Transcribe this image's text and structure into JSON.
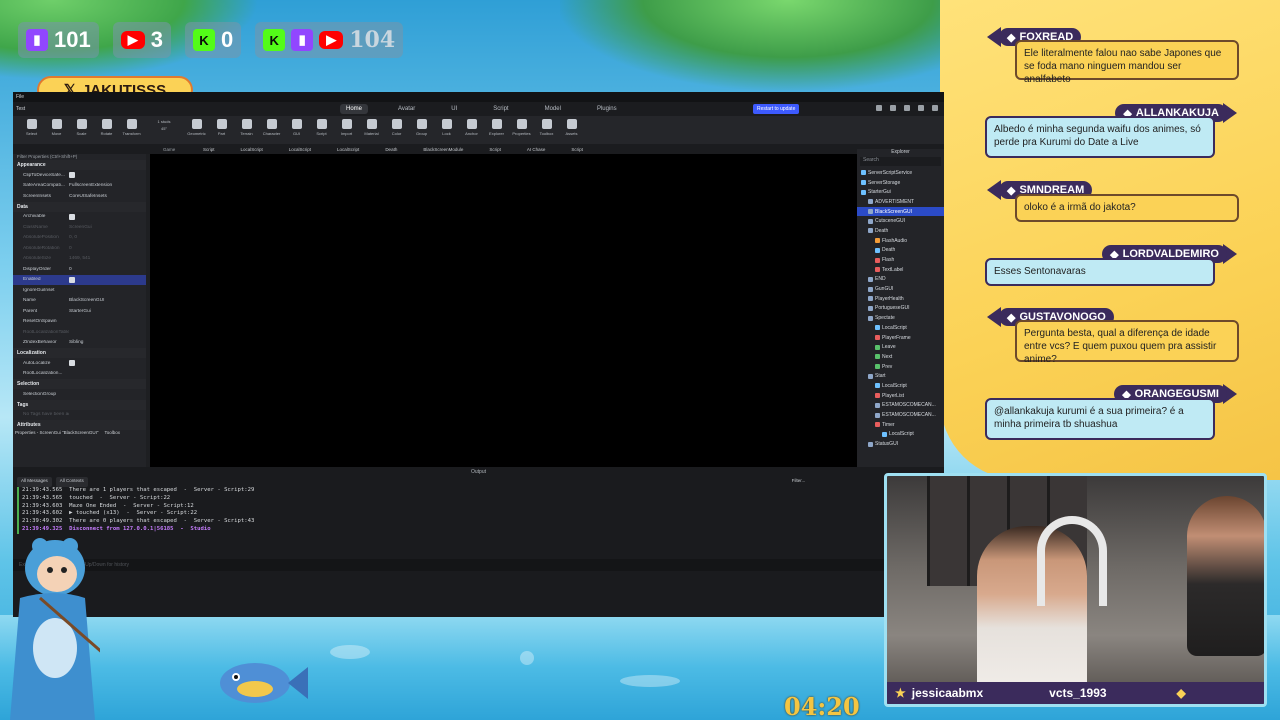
{
  "counters": [
    {
      "platform": "twitch-icon",
      "value": "101"
    },
    {
      "platform": "youtube-icon",
      "value": "3"
    },
    {
      "platform": "kick-icon",
      "value": "0"
    },
    {
      "platform": "all-platforms",
      "value": "104"
    }
  ],
  "handle": "JAKUTISSS",
  "studio": {
    "menu": [
      "File"
    ],
    "place_name": "Test",
    "tabs": [
      "Home",
      "Avatar",
      "UI",
      "Script",
      "Model",
      "Plugins"
    ],
    "active_tab": "Home",
    "restart_label": "Restart to update",
    "tools": [
      "Select",
      "Move",
      "Scale",
      "Rotate",
      "Transform",
      "Geometric",
      "Part",
      "Terrain",
      "Character",
      "GUI",
      "Script",
      "Import",
      "Material",
      "Color",
      "Group",
      "Lock",
      "Anchor",
      "Explorer",
      "Properties",
      "Toolbox",
      "Assets"
    ],
    "snap": {
      "stud": "1 studs",
      "angle": "45°"
    },
    "doc_tabs": [
      "Script",
      "LocalScript",
      "LocalScript",
      "LocalScript",
      "Death",
      "BlackScreenModule",
      "Script",
      "AI Chase",
      "Script"
    ],
    "properties": {
      "title": "Properties - ScreenGui \"BlackScreenGUI\"",
      "filter_placeholder": "Filter Properties (Ctrl+Shift+P)",
      "sections": [
        {
          "name": "Appearance",
          "rows": [
            {
              "name": "ClipToDeviceSafe...",
              "value": "check",
              "disabled": false
            },
            {
              "name": "SafeAreaCompati...",
              "value": "FullscreenExtension",
              "disabled": false
            },
            {
              "name": "ScreenInsets",
              "value": "CoreUISafeInsets",
              "disabled": false
            }
          ]
        },
        {
          "name": "Data",
          "rows": [
            {
              "name": "Archivable",
              "value": "check",
              "disabled": false
            },
            {
              "name": "ClassName",
              "value": "ScreenGui",
              "disabled": true
            },
            {
              "name": "AbsolutePosition",
              "value": "0, 0",
              "disabled": true
            },
            {
              "name": "AbsoluteRotation",
              "value": "0",
              "disabled": true
            },
            {
              "name": "AbsoluteSize",
              "value": "1469, 541",
              "disabled": true
            },
            {
              "name": "DisplayOrder",
              "value": "0",
              "disabled": false
            },
            {
              "name": "Enabled",
              "value": "check",
              "disabled": false,
              "selected": true
            },
            {
              "name": "IgnoreGuiInset",
              "value": "",
              "disabled": false
            },
            {
              "name": "Name",
              "value": "BlackScreenGUI",
              "disabled": false
            },
            {
              "name": "Parent",
              "value": "StarterGui",
              "disabled": false
            },
            {
              "name": "ResetOnSpawn",
              "value": "",
              "disabled": false
            },
            {
              "name": "RootLocalizationTable",
              "value": "",
              "disabled": true
            },
            {
              "name": "ZIndexBehavior",
              "value": "Sibling",
              "disabled": false
            }
          ]
        },
        {
          "name": "Localization",
          "rows": [
            {
              "name": "AutoLocalize",
              "value": "check",
              "disabled": false
            },
            {
              "name": "RootLocalization...",
              "value": "",
              "disabled": false
            }
          ]
        },
        {
          "name": "Selection",
          "rows": [
            {
              "name": "SelectionGroup",
              "value": "",
              "disabled": false
            }
          ]
        },
        {
          "name": "Tags",
          "rows": [
            {
              "name": "No Tags have been added yet",
              "value": "",
              "disabled": true
            }
          ]
        },
        {
          "name": "Attributes",
          "rows": []
        }
      ],
      "footer_tabs": [
        "Properties - ScreenGui \"BlackScreenGUI\"",
        "Toolbox"
      ]
    },
    "viewport_tab": "Game",
    "explorer": {
      "title": "Explorer",
      "search_placeholder": "Search",
      "items": [
        {
          "label": "ServerScriptService",
          "indent": 0,
          "color": "#6ec1ff"
        },
        {
          "label": "ServerStorage",
          "indent": 0,
          "color": "#6ec1ff"
        },
        {
          "label": "StarterGui",
          "indent": 0,
          "color": "#6ec1ff"
        },
        {
          "label": "ADVERTISMENT",
          "indent": 1,
          "color": "#8fa7c9"
        },
        {
          "label": "BlackScreenGUI",
          "indent": 1,
          "color": "#8fa7c9",
          "selected": true
        },
        {
          "label": "CutsceneGUI",
          "indent": 1,
          "color": "#8fa7c9"
        },
        {
          "label": "Death",
          "indent": 1,
          "color": "#8fa7c9"
        },
        {
          "label": "FlashAudio",
          "indent": 2,
          "color": "#f29c38"
        },
        {
          "label": "Death",
          "indent": 2,
          "color": "#6ec1ff"
        },
        {
          "label": "Flash",
          "indent": 2,
          "color": "#e85d5d"
        },
        {
          "label": "TextLabel",
          "indent": 2,
          "color": "#e85d5d"
        },
        {
          "label": "END",
          "indent": 1,
          "color": "#8fa7c9"
        },
        {
          "label": "GunGUI",
          "indent": 1,
          "color": "#8fa7c9"
        },
        {
          "label": "PlayerHealth",
          "indent": 1,
          "color": "#8fa7c9"
        },
        {
          "label": "PortugueseGUI",
          "indent": 1,
          "color": "#8fa7c9"
        },
        {
          "label": "Spectate",
          "indent": 1,
          "color": "#8fa7c9"
        },
        {
          "label": "LocalScript",
          "indent": 2,
          "color": "#6ec1ff"
        },
        {
          "label": "PlayerFrame",
          "indent": 2,
          "color": "#e85d5d"
        },
        {
          "label": "Leave",
          "indent": 2,
          "color": "#59c26b"
        },
        {
          "label": "Next",
          "indent": 2,
          "color": "#59c26b"
        },
        {
          "label": "Prev",
          "indent": 2,
          "color": "#59c26b"
        },
        {
          "label": "Start",
          "indent": 1,
          "color": "#8fa7c9"
        },
        {
          "label": "LocalScript",
          "indent": 2,
          "color": "#6ec1ff"
        },
        {
          "label": "PlayerList",
          "indent": 2,
          "color": "#e85d5d"
        },
        {
          "label": "ESTAMOSCOMECAN...",
          "indent": 2,
          "color": "#8fa7c9"
        },
        {
          "label": "ESTAMOSCOMECAN...",
          "indent": 2,
          "color": "#8fa7c9"
        },
        {
          "label": "Timer",
          "indent": 2,
          "color": "#e85d5d"
        },
        {
          "label": "LocalScript",
          "indent": 3,
          "color": "#6ec1ff"
        },
        {
          "label": "StatusGUI",
          "indent": 1,
          "color": "#8fa7c9"
        }
      ]
    },
    "output": {
      "title": "Output",
      "filters": [
        "All Messages",
        "All Contexts"
      ],
      "filter_label": "Filter...",
      "lines": [
        {
          "text": "21:39:43.565  There are 1 players that escaped  -  Server - Script:29",
          "error": false
        },
        {
          "text": "21:39:43.565  touched  -  Server - Script:22",
          "error": false
        },
        {
          "text": "21:39:43.603  Maze One Ended  -  Server - Script:12",
          "error": false
        },
        {
          "text": "21:39:43.602  ▶ touched (x13)  -  Server - Script:22",
          "error": false
        },
        {
          "text": "21:39:49.302  There are 0 players that escaped  -  Server - Script:43",
          "error": false
        },
        {
          "text": "21:39:49.325  Disconnect from 127.0.0.1|56185  -  Studio",
          "error": true
        }
      ],
      "command_placeholder": "Execute with Ctrl+... use Ctrl+Up/Down for history"
    }
  },
  "chat": [
    {
      "user": "FOXREAD",
      "text": "Ele literalmente falou nao sabe Japones que se foda mano ninguem mandou ser analfabeto",
      "style": "yellow",
      "side": "left"
    },
    {
      "user": "ALLANKAKUJA",
      "text": "Albedo é minha segunda waifu dos animes, só perde pra Kurumi do Date a Live",
      "style": "blue",
      "side": "right"
    },
    {
      "user": "SMNDREAM",
      "text": "oloko é a irmã do jakota?",
      "style": "yellow",
      "side": "left"
    },
    {
      "user": "LORDVALDEMIRO",
      "text": "Esses Sentonavaras",
      "style": "blue",
      "side": "right"
    },
    {
      "user": "GUSTAVONOGO",
      "text": "Pergunta besta, qual a diferença de idade entre vcs? E quem puxou quem pra assistir anime?",
      "style": "yellow",
      "side": "left"
    },
    {
      "user": "ORANGEGUSMI",
      "text": "@allankakuja kurumi é a sua primeira? é a minha primeira tb shuashua",
      "style": "blue",
      "side": "right"
    }
  ],
  "webcam": {
    "left_name": "jessicaabmx",
    "right_name": "vcts_1993"
  },
  "timer": "04:20",
  "colors": {
    "accent": "#fbd256",
    "panel": "#3b2b5c",
    "twitch": "#9146ff",
    "youtube": "#ff0000",
    "kick": "#53fc18"
  }
}
